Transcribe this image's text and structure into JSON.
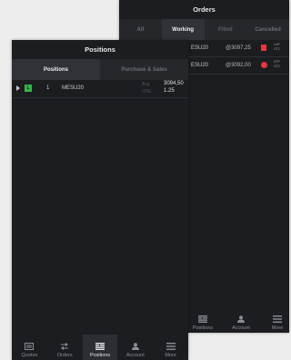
{
  "orders": {
    "title": "Orders",
    "tabs": [
      {
        "label": "All"
      },
      {
        "label": "Working"
      },
      {
        "label": "Filled"
      },
      {
        "label": "Cancelled"
      }
    ],
    "rows": [
      {
        "symbol": "ESU20",
        "price": "@3097,25",
        "type_line1": "LMT",
        "type_line2": "GTC",
        "indicator_color": "#e6373f",
        "indicator_shape": "square"
      },
      {
        "symbol": "ESU20",
        "price": "@3092,00",
        "type_line1": "STP",
        "type_line2": "GTC",
        "indicator_color": "#e6373f",
        "indicator_shape": "circle"
      }
    ],
    "nav": [
      {
        "label": "Positions",
        "icon": "positions-icon"
      },
      {
        "label": "Account",
        "icon": "account-icon"
      },
      {
        "label": "More",
        "icon": "more-icon"
      }
    ]
  },
  "positions": {
    "title": "Positions",
    "tabs": [
      {
        "label": "Positions"
      },
      {
        "label": "Purchase & Sales"
      }
    ],
    "rows": [
      {
        "side": "L",
        "quantity": "1",
        "symbol": "MESU20",
        "label1": "Avg",
        "value1": "3094,50",
        "label2": "OTE",
        "value2": "1.25",
        "side_color": "#39b44a"
      }
    ],
    "nav": [
      {
        "label": "Quotes",
        "icon": "quotes-icon"
      },
      {
        "label": "Orders",
        "icon": "orders-icon"
      },
      {
        "label": "Positions",
        "icon": "positions-icon"
      },
      {
        "label": "Account",
        "icon": "account-icon"
      },
      {
        "label": "More",
        "icon": "more-icon"
      }
    ]
  }
}
